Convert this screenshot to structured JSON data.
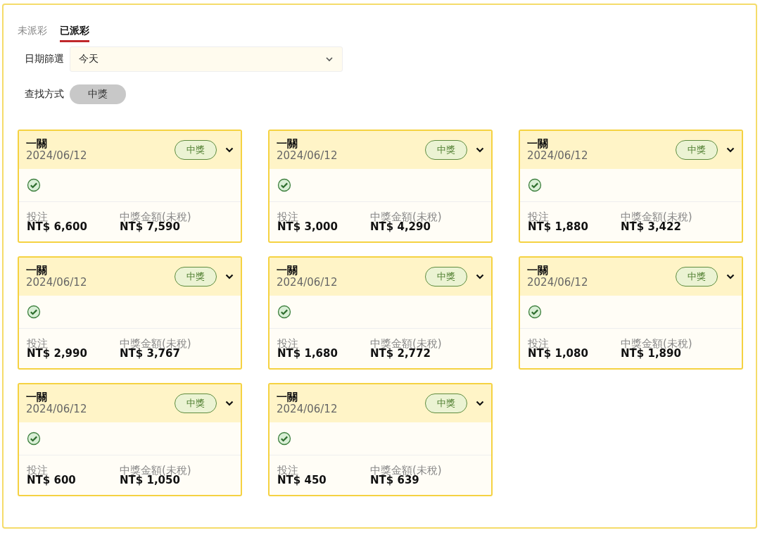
{
  "tabs": [
    {
      "label": "未派彩",
      "selected": false
    },
    {
      "label": "已派彩",
      "selected": true
    }
  ],
  "date_filter": {
    "label": "日期篩選",
    "value": "今天"
  },
  "search_mode": {
    "label": "查找方式",
    "chips": [
      {
        "label": "中獎",
        "selected": true
      }
    ]
  },
  "cards": [
    {
      "title": "一關",
      "date": "2024/06/12",
      "badge": "中獎",
      "stake_label": "投注",
      "stake": "NT$ 6,600",
      "payout_label": "中獎金額(未稅)",
      "payout": "NT$ 7,590"
    },
    {
      "title": "一關",
      "date": "2024/06/12",
      "badge": "中獎",
      "stake_label": "投注",
      "stake": "NT$ 3,000",
      "payout_label": "中獎金額(未稅)",
      "payout": "NT$ 4,290"
    },
    {
      "title": "一關",
      "date": "2024/06/12",
      "badge": "中獎",
      "stake_label": "投注",
      "stake": "NT$ 1,880",
      "payout_label": "中獎金額(未稅)",
      "payout": "NT$ 3,422"
    },
    {
      "title": "一關",
      "date": "2024/06/12",
      "badge": "中獎",
      "stake_label": "投注",
      "stake": "NT$ 2,990",
      "payout_label": "中獎金額(未稅)",
      "payout": "NT$ 3,767"
    },
    {
      "title": "一關",
      "date": "2024/06/12",
      "badge": "中獎",
      "stake_label": "投注",
      "stake": "NT$ 1,680",
      "payout_label": "中獎金額(未稅)",
      "payout": "NT$ 2,772"
    },
    {
      "title": "一關",
      "date": "2024/06/12",
      "badge": "中獎",
      "stake_label": "投注",
      "stake": "NT$ 1,080",
      "payout_label": "中獎金額(未稅)",
      "payout": "NT$ 1,890"
    },
    {
      "title": "一關",
      "date": "2024/06/12",
      "badge": "中獎",
      "stake_label": "投注",
      "stake": "NT$ 600",
      "payout_label": "中獎金額(未稅)",
      "payout": "NT$ 1,050"
    },
    {
      "title": "一關",
      "date": "2024/06/12",
      "badge": "中獎",
      "stake_label": "投注",
      "stake": "NT$ 450",
      "payout_label": "中獎金額(未稅)",
      "payout": "NT$ 639"
    }
  ]
}
